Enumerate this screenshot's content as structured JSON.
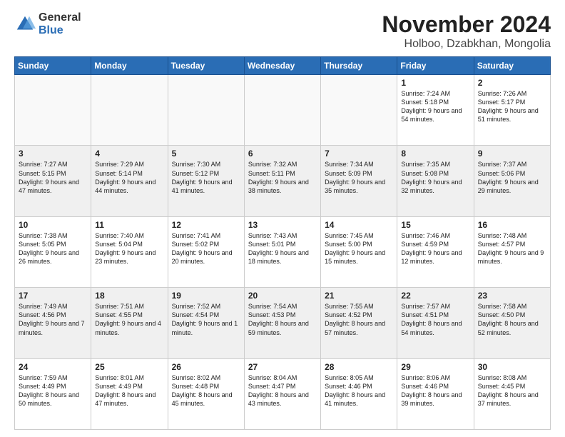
{
  "header": {
    "logo_general": "General",
    "logo_blue": "Blue",
    "month_year": "November 2024",
    "location": "Holboo, Dzabkhan, Mongolia"
  },
  "days_of_week": [
    "Sunday",
    "Monday",
    "Tuesday",
    "Wednesday",
    "Thursday",
    "Friday",
    "Saturday"
  ],
  "weeks": [
    [
      {
        "day": "",
        "info": ""
      },
      {
        "day": "",
        "info": ""
      },
      {
        "day": "",
        "info": ""
      },
      {
        "day": "",
        "info": ""
      },
      {
        "day": "",
        "info": ""
      },
      {
        "day": "1",
        "info": "Sunrise: 7:24 AM\nSunset: 5:18 PM\nDaylight: 9 hours and 54 minutes."
      },
      {
        "day": "2",
        "info": "Sunrise: 7:26 AM\nSunset: 5:17 PM\nDaylight: 9 hours and 51 minutes."
      }
    ],
    [
      {
        "day": "3",
        "info": "Sunrise: 7:27 AM\nSunset: 5:15 PM\nDaylight: 9 hours and 47 minutes."
      },
      {
        "day": "4",
        "info": "Sunrise: 7:29 AM\nSunset: 5:14 PM\nDaylight: 9 hours and 44 minutes."
      },
      {
        "day": "5",
        "info": "Sunrise: 7:30 AM\nSunset: 5:12 PM\nDaylight: 9 hours and 41 minutes."
      },
      {
        "day": "6",
        "info": "Sunrise: 7:32 AM\nSunset: 5:11 PM\nDaylight: 9 hours and 38 minutes."
      },
      {
        "day": "7",
        "info": "Sunrise: 7:34 AM\nSunset: 5:09 PM\nDaylight: 9 hours and 35 minutes."
      },
      {
        "day": "8",
        "info": "Sunrise: 7:35 AM\nSunset: 5:08 PM\nDaylight: 9 hours and 32 minutes."
      },
      {
        "day": "9",
        "info": "Sunrise: 7:37 AM\nSunset: 5:06 PM\nDaylight: 9 hours and 29 minutes."
      }
    ],
    [
      {
        "day": "10",
        "info": "Sunrise: 7:38 AM\nSunset: 5:05 PM\nDaylight: 9 hours and 26 minutes."
      },
      {
        "day": "11",
        "info": "Sunrise: 7:40 AM\nSunset: 5:04 PM\nDaylight: 9 hours and 23 minutes."
      },
      {
        "day": "12",
        "info": "Sunrise: 7:41 AM\nSunset: 5:02 PM\nDaylight: 9 hours and 20 minutes."
      },
      {
        "day": "13",
        "info": "Sunrise: 7:43 AM\nSunset: 5:01 PM\nDaylight: 9 hours and 18 minutes."
      },
      {
        "day": "14",
        "info": "Sunrise: 7:45 AM\nSunset: 5:00 PM\nDaylight: 9 hours and 15 minutes."
      },
      {
        "day": "15",
        "info": "Sunrise: 7:46 AM\nSunset: 4:59 PM\nDaylight: 9 hours and 12 minutes."
      },
      {
        "day": "16",
        "info": "Sunrise: 7:48 AM\nSunset: 4:57 PM\nDaylight: 9 hours and 9 minutes."
      }
    ],
    [
      {
        "day": "17",
        "info": "Sunrise: 7:49 AM\nSunset: 4:56 PM\nDaylight: 9 hours and 7 minutes."
      },
      {
        "day": "18",
        "info": "Sunrise: 7:51 AM\nSunset: 4:55 PM\nDaylight: 9 hours and 4 minutes."
      },
      {
        "day": "19",
        "info": "Sunrise: 7:52 AM\nSunset: 4:54 PM\nDaylight: 9 hours and 1 minute."
      },
      {
        "day": "20",
        "info": "Sunrise: 7:54 AM\nSunset: 4:53 PM\nDaylight: 8 hours and 59 minutes."
      },
      {
        "day": "21",
        "info": "Sunrise: 7:55 AM\nSunset: 4:52 PM\nDaylight: 8 hours and 57 minutes."
      },
      {
        "day": "22",
        "info": "Sunrise: 7:57 AM\nSunset: 4:51 PM\nDaylight: 8 hours and 54 minutes."
      },
      {
        "day": "23",
        "info": "Sunrise: 7:58 AM\nSunset: 4:50 PM\nDaylight: 8 hours and 52 minutes."
      }
    ],
    [
      {
        "day": "24",
        "info": "Sunrise: 7:59 AM\nSunset: 4:49 PM\nDaylight: 8 hours and 50 minutes."
      },
      {
        "day": "25",
        "info": "Sunrise: 8:01 AM\nSunset: 4:49 PM\nDaylight: 8 hours and 47 minutes."
      },
      {
        "day": "26",
        "info": "Sunrise: 8:02 AM\nSunset: 4:48 PM\nDaylight: 8 hours and 45 minutes."
      },
      {
        "day": "27",
        "info": "Sunrise: 8:04 AM\nSunset: 4:47 PM\nDaylight: 8 hours and 43 minutes."
      },
      {
        "day": "28",
        "info": "Sunrise: 8:05 AM\nSunset: 4:46 PM\nDaylight: 8 hours and 41 minutes."
      },
      {
        "day": "29",
        "info": "Sunrise: 8:06 AM\nSunset: 4:46 PM\nDaylight: 8 hours and 39 minutes."
      },
      {
        "day": "30",
        "info": "Sunrise: 8:08 AM\nSunset: 4:45 PM\nDaylight: 8 hours and 37 minutes."
      }
    ]
  ]
}
